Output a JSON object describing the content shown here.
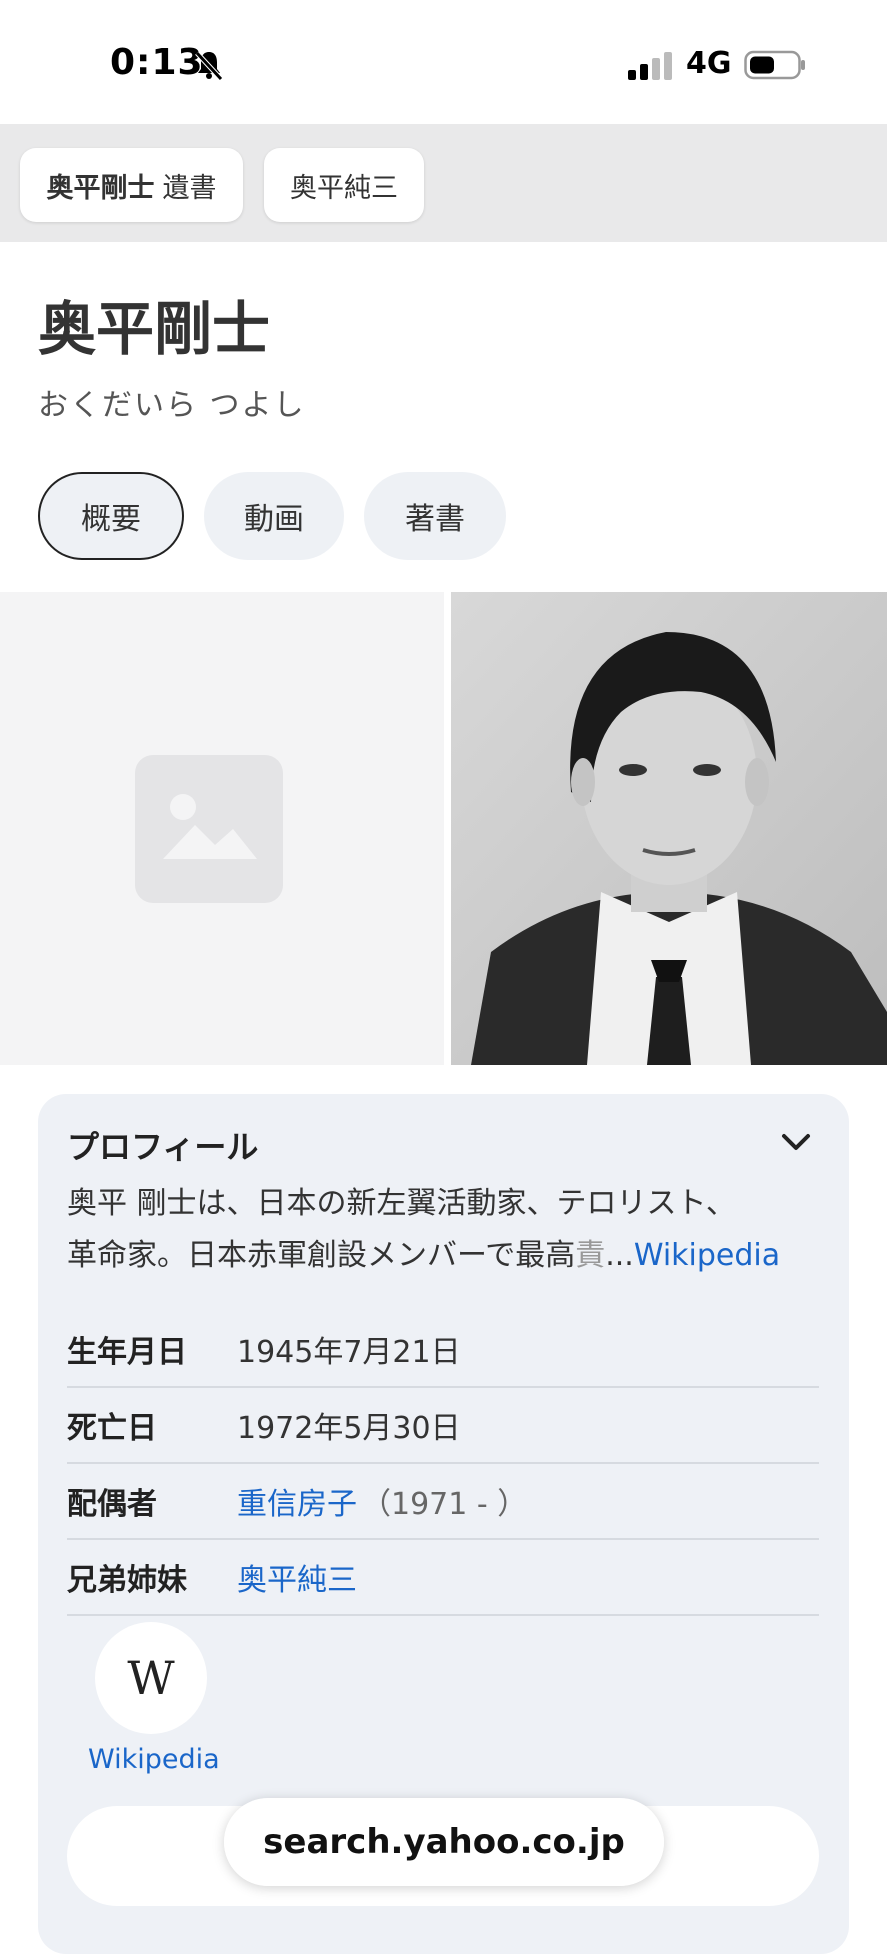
{
  "status_bar": {
    "time": "0:13",
    "network": "4G"
  },
  "suggestions": [
    {
      "bold": "奥平剛士",
      "rest": "遺書"
    },
    {
      "bold": "",
      "rest": "奥平純三"
    }
  ],
  "entity": {
    "title": "奥平剛士",
    "reading": "おくだいら つよし"
  },
  "tabs": [
    "概要",
    "動画",
    "著書"
  ],
  "profile": {
    "heading": "プロフィール",
    "desc_line1": "奥平 剛士は、日本の新左翼活動家、テロリスト、",
    "desc_line2": "革命家。日本赤軍創設メンバーで最高",
    "desc_fade": "責",
    "desc_ellipsis": "...",
    "desc_link": "Wikipedia",
    "rows": [
      {
        "label": "生年月日",
        "value": "1945年7月21日"
      },
      {
        "label": "死亡日",
        "value": "1972年5月30日"
      },
      {
        "label": "配偶者",
        "value": "重信房子",
        "extra": "（1971 - ）"
      },
      {
        "label": "兄弟姉妹",
        "value": "奥平純三"
      }
    ],
    "source_letter": "W",
    "source_caption": "Wikipedia"
  },
  "url": "search.yahoo.co.jp",
  "colors": {
    "link": "#1a66c9",
    "card_bg": "#eef1f6",
    "strip_bg": "#e9e9ea"
  }
}
